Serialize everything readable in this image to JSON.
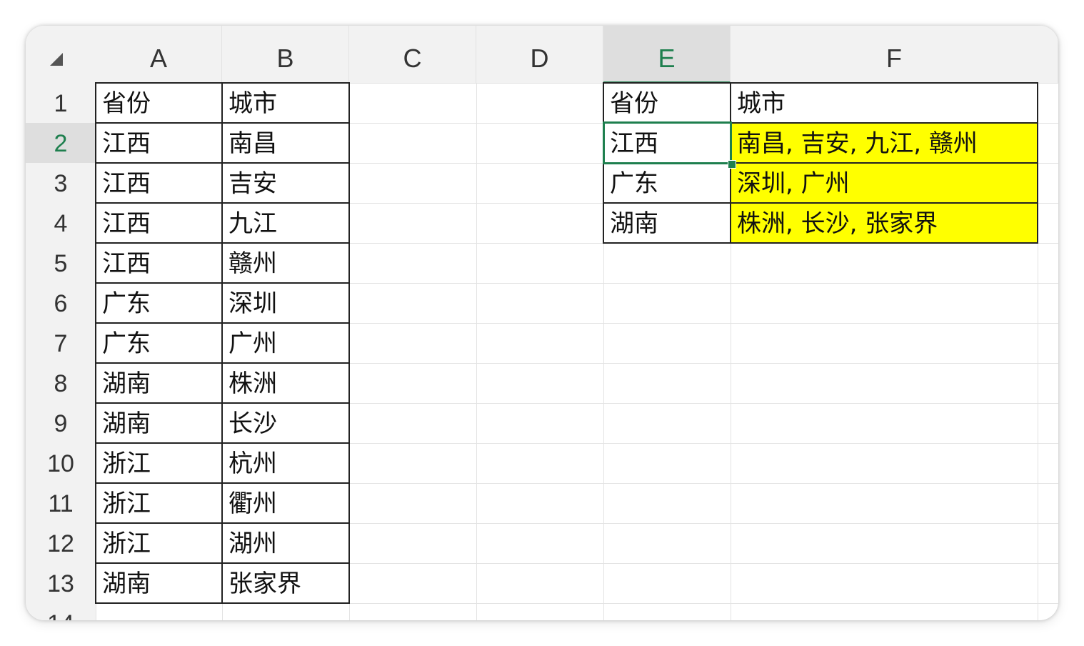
{
  "columns": [
    "A",
    "B",
    "C",
    "D",
    "E",
    "F"
  ],
  "rows": [
    "1",
    "2",
    "3",
    "4",
    "5",
    "6",
    "7",
    "8",
    "9",
    "10",
    "11",
    "12",
    "13",
    "14"
  ],
  "selected_column": "E",
  "selected_row": "2",
  "source_table": {
    "headers": [
      "省份",
      "城市"
    ],
    "rows": [
      [
        "江西",
        "南昌"
      ],
      [
        "江西",
        "吉安"
      ],
      [
        "江西",
        "九江"
      ],
      [
        "江西",
        "赣州"
      ],
      [
        "广东",
        "深圳"
      ],
      [
        "广东",
        "广州"
      ],
      [
        "湖南",
        "株洲"
      ],
      [
        "湖南",
        "长沙"
      ],
      [
        "浙江",
        "杭州"
      ],
      [
        "浙江",
        "衢州"
      ],
      [
        "浙江",
        "湖州"
      ],
      [
        "湖南",
        "张家界"
      ]
    ]
  },
  "result_table": {
    "headers": [
      "省份",
      "城市"
    ],
    "rows": [
      [
        "江西",
        "南昌, 吉安, 九江, 赣州"
      ],
      [
        "广东",
        "深圳, 广州"
      ],
      [
        "湖南",
        "株洲, 长沙, 张家界"
      ]
    ],
    "highlight_color": "#ffff00"
  },
  "accent_color": "#1e7f4e"
}
